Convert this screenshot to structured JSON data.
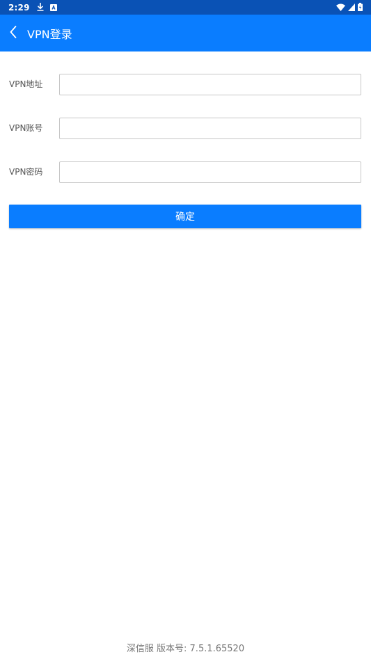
{
  "status_bar": {
    "time": "2:29",
    "left_icons": [
      "download-icon",
      "app-notification-icon"
    ],
    "right_icons": [
      "wifi-icon",
      "cell-signal-icon",
      "battery-icon"
    ]
  },
  "app_bar": {
    "title": "VPN登录",
    "back_icon": "chevron-left-icon",
    "color": "#0a7dff"
  },
  "form": {
    "address": {
      "label": "VPN地址",
      "value": "",
      "placeholder": ""
    },
    "account": {
      "label": "VPN账号",
      "value": "",
      "placeholder": ""
    },
    "password": {
      "label": "VPN密码",
      "value": "",
      "placeholder": ""
    }
  },
  "confirm_button": {
    "label": "确定"
  },
  "footer": {
    "text": "深信服  版本号: 7.5.1.65520"
  }
}
